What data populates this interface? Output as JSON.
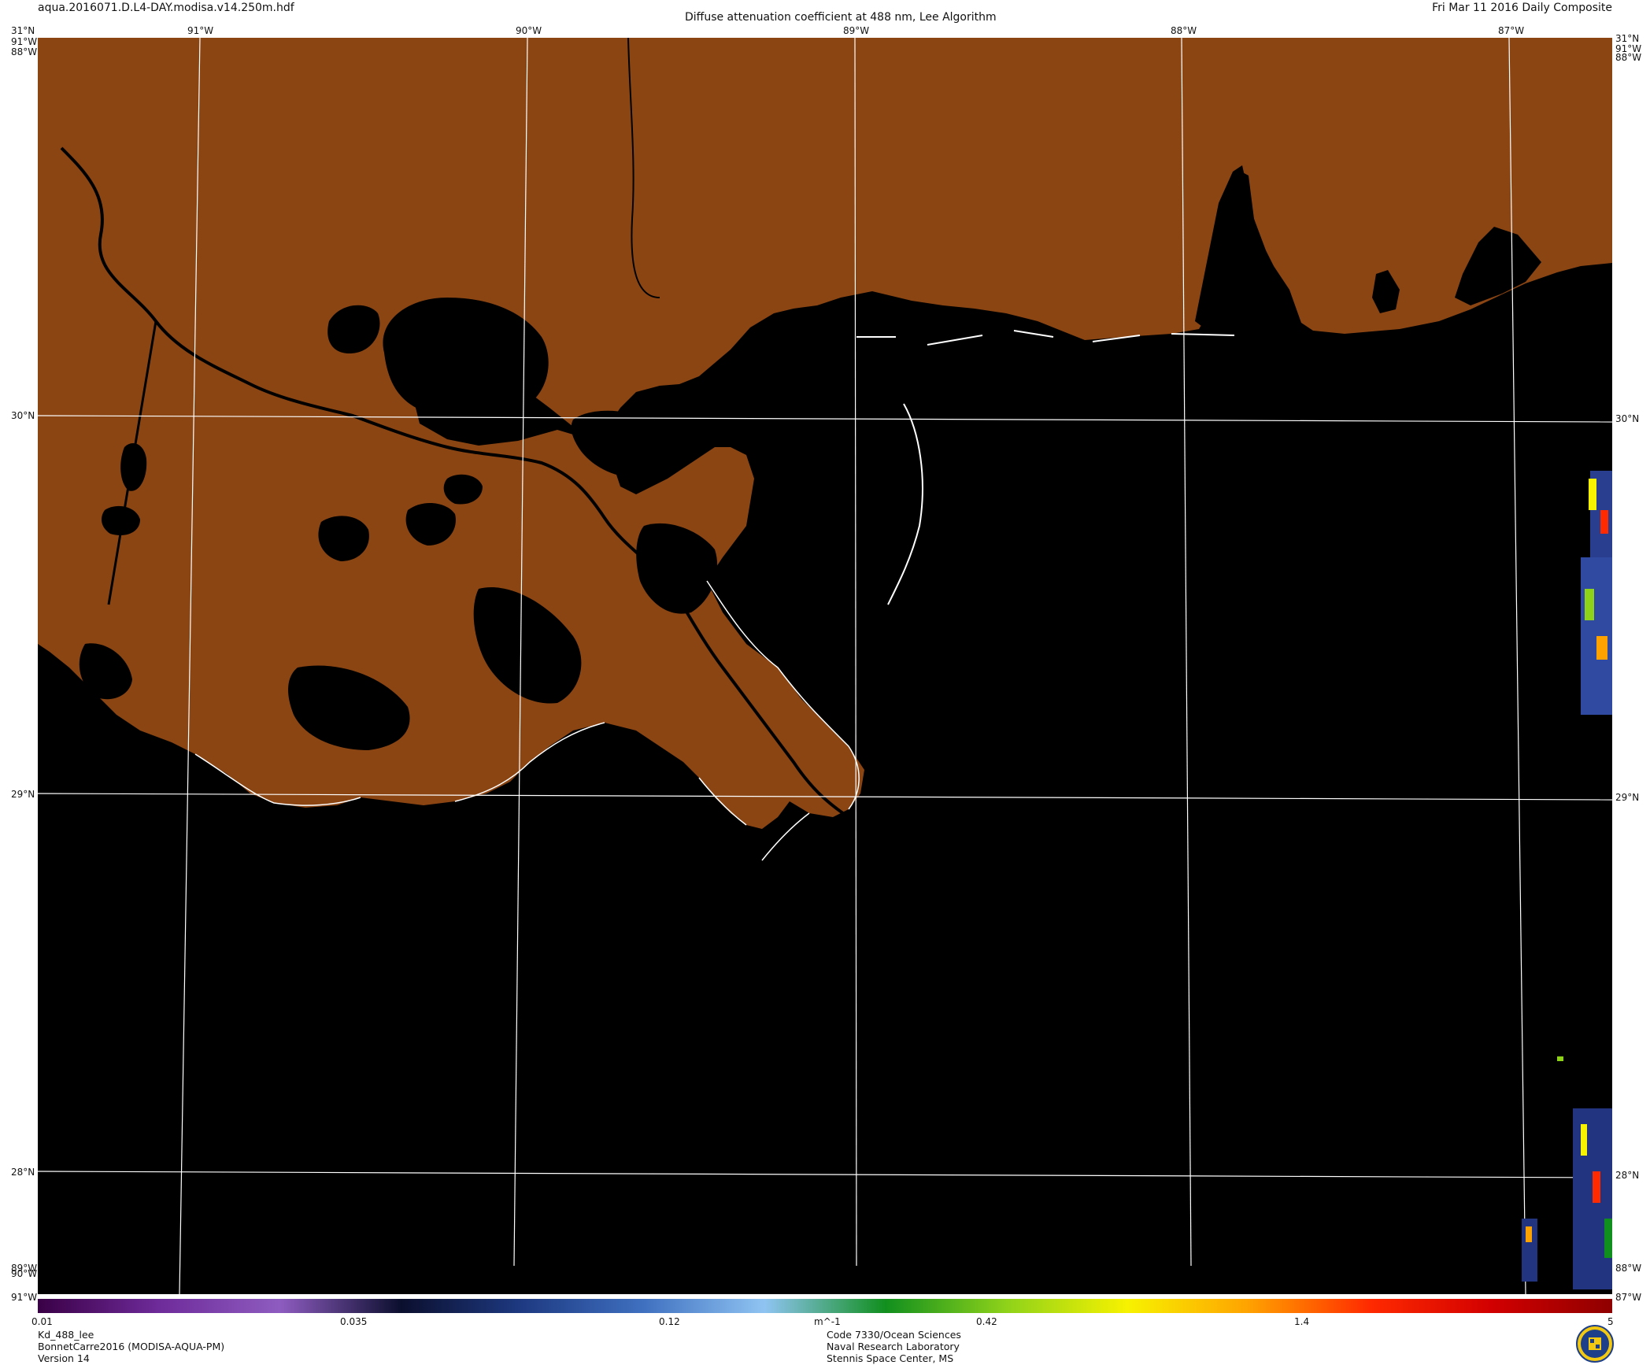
{
  "header": {
    "filename": "aqua.2016071.D.L4-DAY.modisa.v14.250m.hdf",
    "title": "Diffuse attenuation coefficient at 488 nm, Lee Algorithm",
    "date": "Fri Mar 11 2016 Daily Composite"
  },
  "map": {
    "top_left_corner": [
      "31°N",
      "91°W",
      "88°W"
    ],
    "top_right_corner": [
      "31°N",
      "91°W",
      "88°W"
    ],
    "bottom_left_corner": [
      "89°W",
      "90°W",
      "91°W"
    ],
    "bottom_right_corner": [
      "88°W",
      "87°W"
    ],
    "lon_labels": [
      "91°W",
      "90°W",
      "89°W",
      "88°W",
      "87°W"
    ],
    "lat_labels_left": [
      "30°N",
      "29°N",
      "28°N"
    ],
    "lat_labels_right": [
      "30°N",
      "29°N",
      "28°N"
    ],
    "colors": {
      "land": "#8b4513",
      "water": "#000000",
      "grid": "#ffffff",
      "coastline": "#ffffff"
    }
  },
  "colorbar": {
    "ticks": [
      "0.01",
      "0.035",
      "0.12",
      "0.42",
      "1.4",
      "5"
    ],
    "unit": "m^-1",
    "stops": [
      "#3a0046",
      "#6e2b9a",
      "#8e5cc0",
      "#0b0f2e",
      "#1e3a82",
      "#3f70c0",
      "#8fc4f2",
      "#118f1e",
      "#8fd21a",
      "#f7f200",
      "#ffa200",
      "#ff2a00",
      "#d20000",
      "#8f0000"
    ]
  },
  "footer": {
    "left": [
      "Kd_488_lee",
      "BonnetCarre2016 (MODISA-AQUA-PM)",
      "Version 14"
    ],
    "center": [
      "Code 7330/Ocean Sciences",
      "Naval Research Laboratory",
      "Stennis Space Center, MS"
    ]
  }
}
